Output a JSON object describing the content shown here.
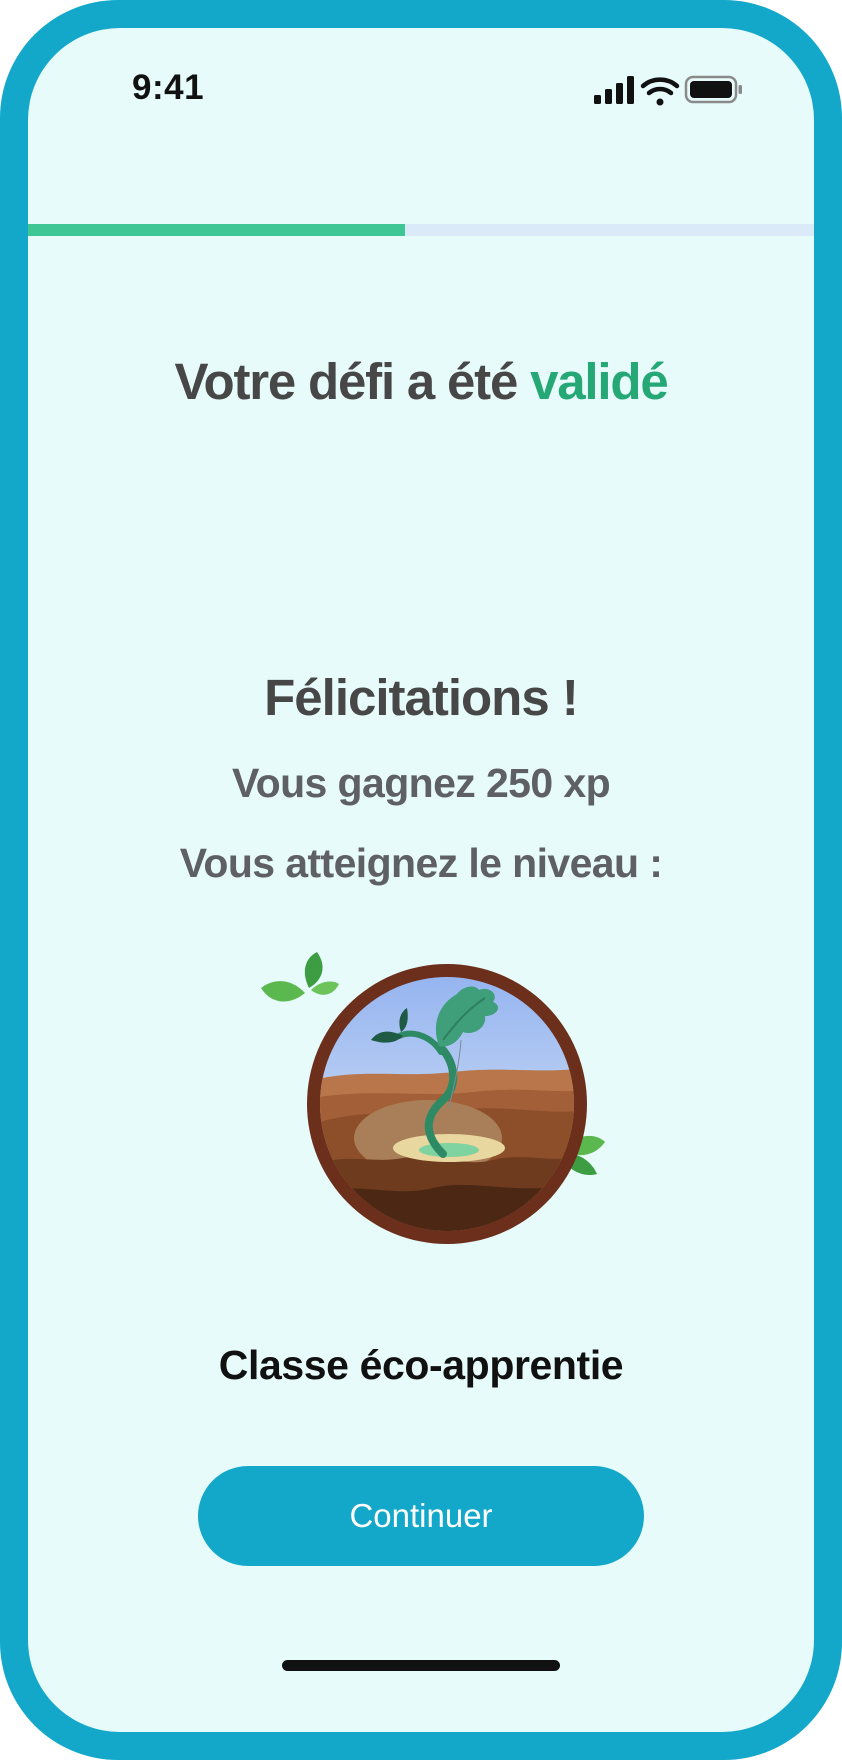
{
  "status_bar": {
    "time": "9:41",
    "icons": [
      "cellular-signal-icon",
      "wifi-icon",
      "battery-icon"
    ]
  },
  "progress": {
    "fraction": 0.48
  },
  "headline": {
    "prefix": "Votre défi a été ",
    "highlight": "validé"
  },
  "result": {
    "congrats": "Félicitations !",
    "xp": "Vous gagnez 250 xp",
    "level_intro": "Vous atteignez le niveau :",
    "level_name": "Classe éco-apprentie"
  },
  "actions": {
    "continue_label": "Continuer"
  },
  "colors": {
    "frame": "#13a8c9",
    "background": "#e6fbfa",
    "accent_green": "#26a776",
    "progress_fill": "#3ec694",
    "progress_track": "#dbeaf8",
    "button": "#13a8c9"
  }
}
